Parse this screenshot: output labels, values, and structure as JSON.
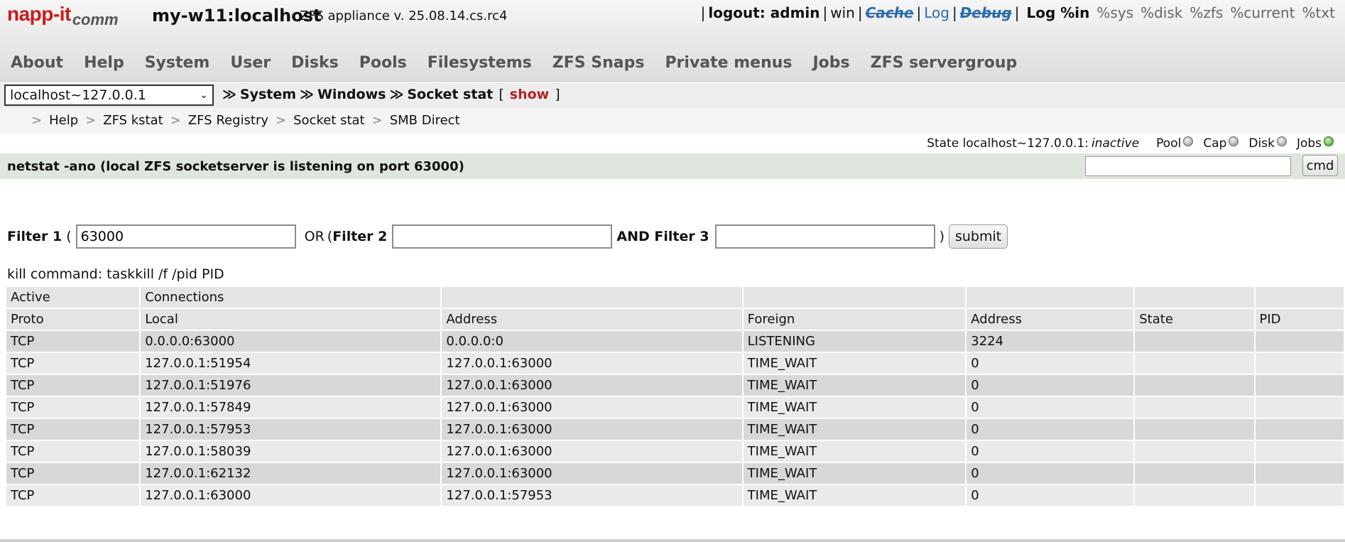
{
  "header": {
    "logo_main": "napp-it",
    "logo_sub": "comm",
    "hostname": "my-w11:localhost",
    "version": "ZFS appliance v. 25.08.14.cs.rc4"
  },
  "toplinks": {
    "logout": "logout: admin",
    "win": "win",
    "cache": "Cache",
    "log": "Log",
    "debug": "Debug",
    "log_in": "Log %in",
    "sys": "%sys",
    "disk": "%disk",
    "zfs": "%zfs",
    "current": "%current",
    "txt": "%txt"
  },
  "mainnav": [
    "About",
    "Help",
    "System",
    "User",
    "Disks",
    "Pools",
    "Filesystems",
    "ZFS Snaps",
    "Private menus",
    "Jobs",
    "ZFS servergroup"
  ],
  "breadcrumb": {
    "host_select": "localhost~127.0.0.1",
    "items": [
      "System",
      "Windows",
      "Socket stat"
    ],
    "show_label": "show"
  },
  "submenu": [
    "Help",
    "ZFS kstat",
    "ZFS Registry",
    "Socket stat",
    "SMB Direct"
  ],
  "state": {
    "label": "State localhost~127.0.0.1:",
    "value": "inactive",
    "pool": "Pool",
    "cap": "Cap",
    "disk": "Disk",
    "jobs": "Jobs"
  },
  "command": {
    "title": "netstat -ano (local ZFS socketserver is listening on port 63000)",
    "cmd_label": "cmd",
    "cmd_value": ""
  },
  "filters": {
    "filter1_label": "Filter 1",
    "filter1_value": "63000",
    "or_label": "OR",
    "filter2_label": "Filter 2",
    "filter2_value": "",
    "and_label": "AND Filter 3",
    "filter3_value": "",
    "submit_label": "submit"
  },
  "kill_command": "kill command: taskkill /f /pid PID",
  "table": {
    "header1": [
      "Active",
      "Connections",
      "",
      "",
      "",
      "",
      ""
    ],
    "header2": [
      "Proto",
      "Local",
      "Address",
      "Foreign",
      "Address",
      "State",
      "PID"
    ],
    "rows": [
      [
        "TCP",
        "0.0.0.0:63000",
        "0.0.0.0:0",
        "LISTENING",
        "3224",
        "",
        ""
      ],
      [
        "TCP",
        "127.0.0.1:51954",
        "127.0.0.1:63000",
        "TIME_WAIT",
        "0",
        "",
        ""
      ],
      [
        "TCP",
        "127.0.0.1:51976",
        "127.0.0.1:63000",
        "TIME_WAIT",
        "0",
        "",
        ""
      ],
      [
        "TCP",
        "127.0.0.1:57849",
        "127.0.0.1:63000",
        "TIME_WAIT",
        "0",
        "",
        ""
      ],
      [
        "TCP",
        "127.0.0.1:57953",
        "127.0.0.1:63000",
        "TIME_WAIT",
        "0",
        "",
        ""
      ],
      [
        "TCP",
        "127.0.0.1:58039",
        "127.0.0.1:63000",
        "TIME_WAIT",
        "0",
        "",
        ""
      ],
      [
        "TCP",
        "127.0.0.1:62132",
        "127.0.0.1:63000",
        "TIME_WAIT",
        "0",
        "",
        ""
      ],
      [
        "TCP",
        "127.0.0.1:63000",
        "127.0.0.1:57953",
        "TIME_WAIT",
        "0",
        "",
        ""
      ]
    ]
  }
}
